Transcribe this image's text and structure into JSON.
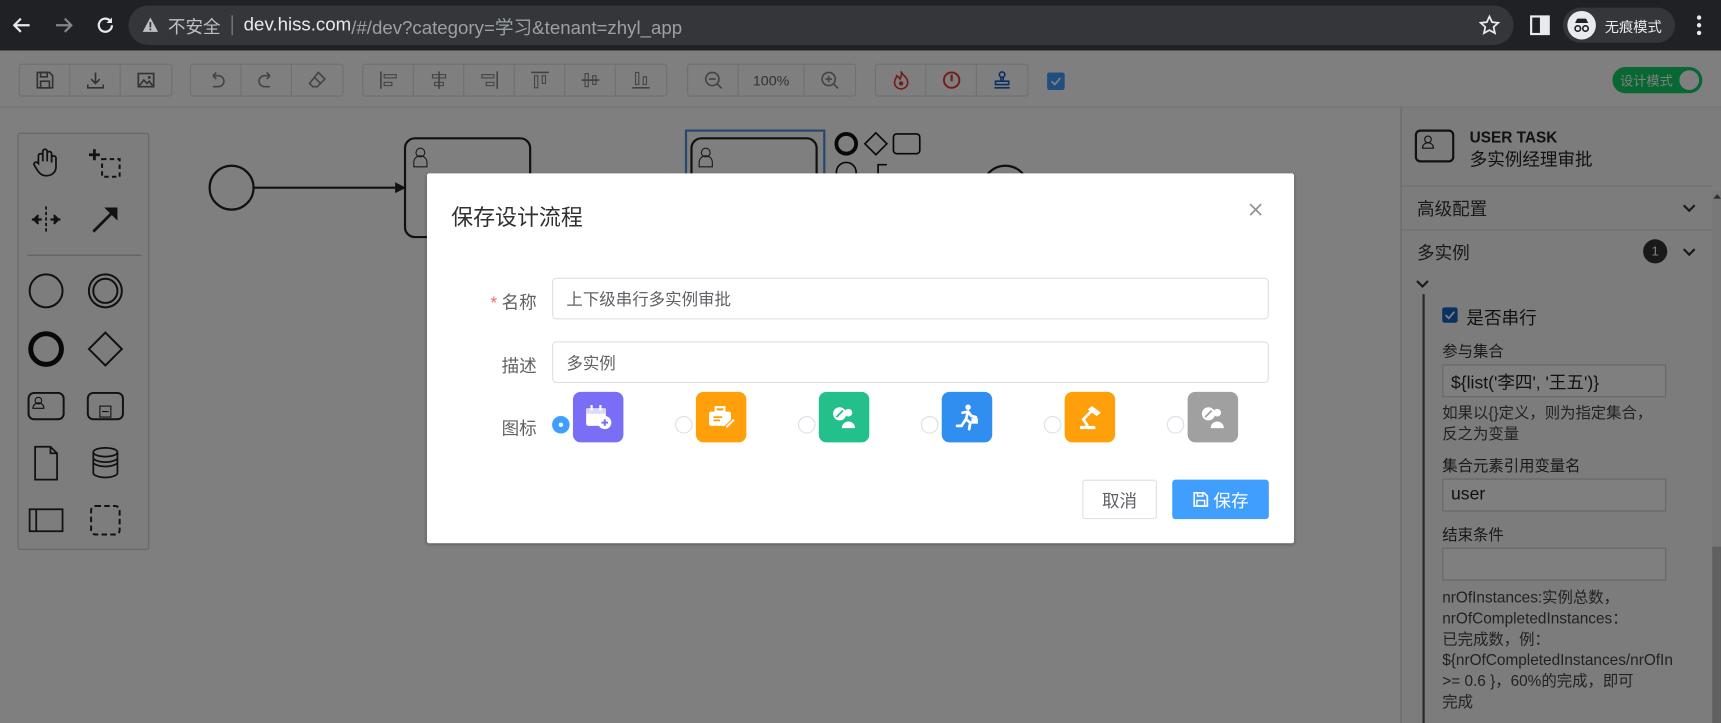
{
  "browser": {
    "insecure_label": "不安全",
    "url_host": "dev.hiss.com",
    "url_path": "/#/dev?category=学习&tenant=zhyl_app",
    "incognito_label": "无痕模式"
  },
  "toolbar": {
    "zoom": "100%",
    "design_mode_label": "设计模式"
  },
  "properties": {
    "element_type": "USER TASK",
    "element_name": "多实例经理审批",
    "section_advanced": "高级配置",
    "section_multi": "多实例",
    "multi_badge": "1",
    "sequential_label": "是否串行",
    "collection_label": "参与集合",
    "collection_value": "${list('李四', '王五')}",
    "collection_hint_1": "如果以{}定义，则为指定集合，",
    "collection_hint_2": "反之为变量",
    "element_var_label": "集合元素引用变量名",
    "element_var_value": "user",
    "completion_label": "结束条件",
    "completion_value": "",
    "completion_hint_1": "nrOfInstances:实例总数，",
    "completion_hint_2": "nrOfCompletedInstances：",
    "completion_hint_3": "已完成数，例：",
    "completion_hint_4": "${nrOfCompletedInstances/nrOfIn",
    "completion_hint_5": ">= 0.6 }，60%的完成，即可",
    "completion_hint_6": "完成"
  },
  "dialog": {
    "title": "保存设计流程",
    "name_label": "名称",
    "name_value": "上下级串行多实例审批",
    "desc_label": "描述",
    "desc_value": "多实例",
    "icon_label": "图标",
    "icons": [
      {
        "name": "calendar-add-icon",
        "color": "#7b6ef6",
        "selected": true
      },
      {
        "name": "briefcase-edit-icon",
        "color": "#ff9f0a",
        "selected": false
      },
      {
        "name": "person-percent-icon",
        "color": "#23c08c",
        "selected": false
      },
      {
        "name": "running-person-icon",
        "color": "#2f8ef0",
        "selected": false
      },
      {
        "name": "desk-lamp-icon",
        "color": "#ff9f0a",
        "selected": false
      },
      {
        "name": "person-percent-gray-icon",
        "color": "#a0a0a0",
        "selected": false
      }
    ],
    "cancel_label": "取消",
    "save_label": "保存"
  }
}
